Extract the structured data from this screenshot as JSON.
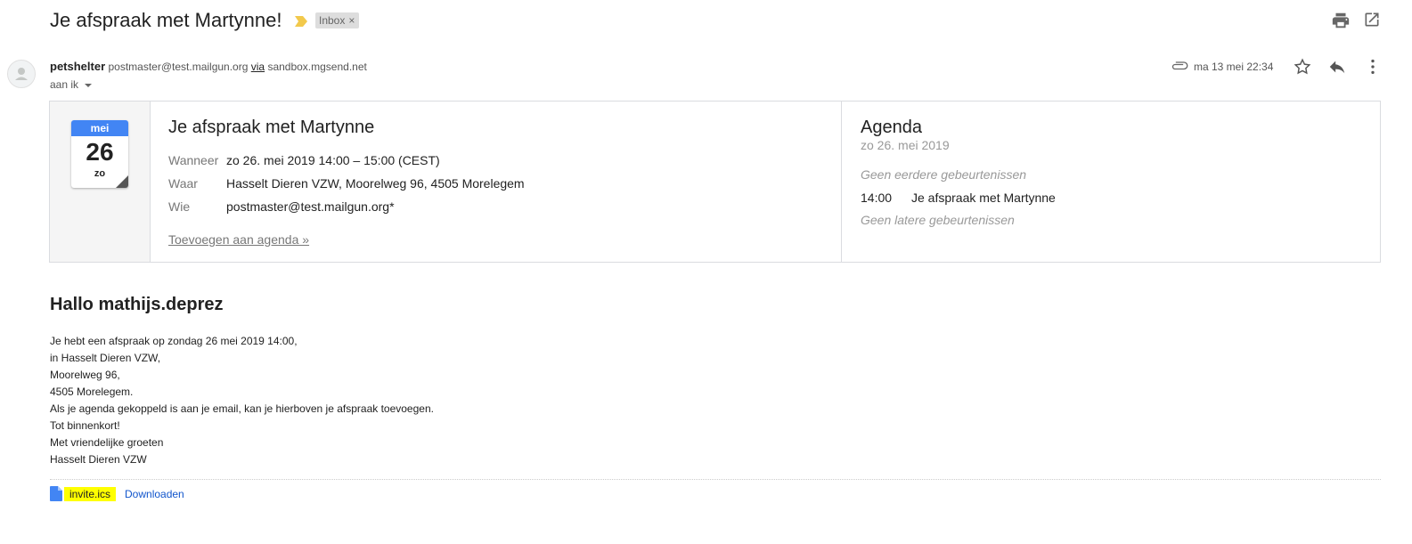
{
  "header": {
    "subject": "Je afspraak met Martynne!",
    "label": "Inbox",
    "label_remove": "×",
    "importance_icon": "importance-marker-icon",
    "print_icon": "print-icon",
    "open_new_window_icon": "open-in-new-window-icon"
  },
  "sender": {
    "name": "petshelter",
    "email": "postmaster@test.mailgun.org",
    "via_label": "via",
    "via_domain": "sandbox.mgsend.net",
    "to": "aan ik",
    "date": "ma 13 mei 22:34"
  },
  "invitation": {
    "calendar_month": "mei",
    "calendar_day": "26",
    "calendar_dow": "zo",
    "title": "Je afspraak met Martynne",
    "when_label": "Wanneer",
    "when_value": "zo 26. mei 2019 14:00 – 15:00 (CEST)",
    "where_label": "Waar",
    "where_value": "Hasselt Dieren VZW, Moorelweg 96, 4505 Morelegem",
    "who_label": "Wie",
    "who_value": "postmaster@test.mailgun.org*",
    "add_link": "Toevoegen aan agenda »"
  },
  "agenda": {
    "title": "Agenda",
    "date": "zo 26. mei 2019",
    "no_earlier": "Geen eerdere gebeurtenissen",
    "event_time": "14:00",
    "event_title": "Je afspraak met Martynne",
    "no_later": "Geen latere gebeurtenissen"
  },
  "body": {
    "greeting": "Hallo mathijs.deprez",
    "lines": [
      "Je hebt een afspraak op zondag 26 mei 2019 14:00,",
      "in Hasselt Dieren VZW,",
      "Moorelweg 96,",
      "4505 Morelegem.",
      "Als je agenda gekoppeld is aan je email, kan je hierboven je afspraak toevoegen.",
      "Tot binnenkort!",
      "Met vriendelijke groeten",
      "Hasselt Dieren VZW"
    ]
  },
  "attachment": {
    "file_name": "invite.ics",
    "download_label": "Downloaden"
  },
  "colors": {
    "accent_blue": "#4285f4",
    "link_blue": "#1155cc",
    "highlight_yellow": "#ffff00",
    "importance_yellow": "#f2c94c"
  }
}
